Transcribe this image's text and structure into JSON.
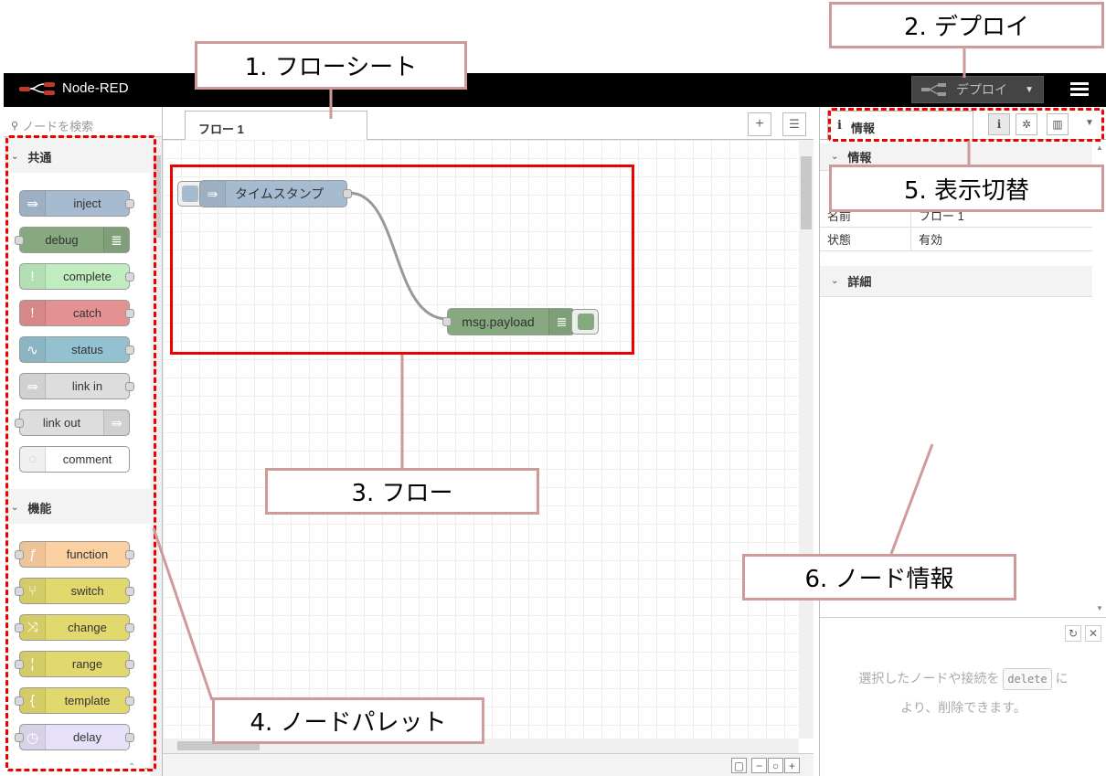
{
  "header": {
    "app_name": "Node-RED",
    "deploy_label": "デプロイ",
    "logo_icon": "node-red-logo-icon",
    "menu_icon": "hamburger-menu-icon"
  },
  "palette": {
    "search_placeholder": "ノードを検索",
    "categories": [
      {
        "name": "共通",
        "nodes": [
          {
            "label": "inject",
            "color": "#a6bbcf",
            "icon": "arrow-right-icon"
          },
          {
            "label": "debug",
            "color": "#87a980",
            "icon": "list-icon"
          },
          {
            "label": "complete",
            "color": "#c0edc0",
            "icon": "exclamation-icon"
          },
          {
            "label": "catch",
            "color": "#e49191",
            "icon": "exclamation-icon"
          },
          {
            "label": "status",
            "color": "#94c1d0",
            "icon": "pulse-icon"
          },
          {
            "label": "link in",
            "color": "#dddddd",
            "icon": "link-in-icon"
          },
          {
            "label": "link out",
            "color": "#dddddd",
            "icon": "link-out-icon"
          },
          {
            "label": "comment",
            "color": "#ffffff",
            "icon": "comment-icon"
          }
        ]
      },
      {
        "name": "機能",
        "nodes": [
          {
            "label": "function",
            "color": "#fdd0a2",
            "icon": "function-icon"
          },
          {
            "label": "switch",
            "color": "#e2d96e",
            "icon": "switch-icon"
          },
          {
            "label": "change",
            "color": "#e2d96e",
            "icon": "shuffle-icon"
          },
          {
            "label": "range",
            "color": "#e2d96e",
            "icon": "range-icon"
          },
          {
            "label": "template",
            "color": "#e2d96e",
            "icon": "brace-icon"
          },
          {
            "label": "delay",
            "color": "#e6e0f8",
            "icon": "timer-icon"
          }
        ]
      }
    ]
  },
  "workspace": {
    "tab_label": "フロー 1",
    "nodes": [
      {
        "label": "タイムスタンプ",
        "color": "#a6bbcf",
        "icon": "arrow-right-icon"
      },
      {
        "label": "msg.payload",
        "color": "#87a980",
        "icon": "list-icon"
      }
    ]
  },
  "sidebar": {
    "tab_label": "情報",
    "section_info": "情報",
    "rows": [
      {
        "key": "名前",
        "value": "フロー 1"
      },
      {
        "key": "状態",
        "value": "有効"
      }
    ],
    "section_detail": "詳細",
    "help_text_1": "選択したノードや接続を",
    "help_key": "delete",
    "help_text_2": "に",
    "help_text_3": "より、削除できます。"
  },
  "annotations": [
    {
      "label": "1. フローシート"
    },
    {
      "label": "2. デプロイ"
    },
    {
      "label": "3. フロー"
    },
    {
      "label": "4. ノードパレット"
    },
    {
      "label": "5. 表示切替"
    },
    {
      "label": "6. ノード情報"
    }
  ],
  "colors": {
    "annotation_border": "#cf9a9a",
    "highlight_red": "#e00000"
  }
}
